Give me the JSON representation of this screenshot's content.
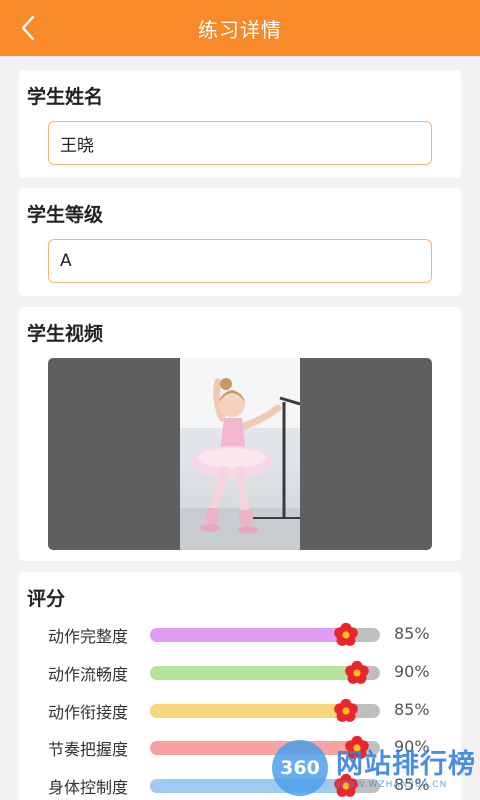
{
  "header": {
    "title": "练习详情",
    "back_icon": "chevron-left-icon"
  },
  "student_name": {
    "label": "学生姓名",
    "value": "王晓"
  },
  "student_grade": {
    "label": "学生等级",
    "value": "A"
  },
  "student_video": {
    "label": "学生视频"
  },
  "scores": {
    "label": "评分",
    "items": [
      {
        "label": "动作完整度",
        "value": "85%",
        "percent": 85,
        "color": "#e29cf2"
      },
      {
        "label": "动作流畅度",
        "value": "90%",
        "percent": 90,
        "color": "#b5e39c"
      },
      {
        "label": "动作衔接度",
        "value": "85%",
        "percent": 85,
        "color": "#f8d67a"
      },
      {
        "label": "节奏把握度",
        "value": "90%",
        "percent": 90,
        "color": "#f7a3a3"
      },
      {
        "label": "身体控制度",
        "value": "85%",
        "percent": 85,
        "color": "#9fcaf2"
      }
    ]
  },
  "colors": {
    "accent": "#f88a2a",
    "field_border": "#f3b57a",
    "track": "#bfbfbf",
    "flower": "#e8262b"
  },
  "watermark": {
    "badge": "360",
    "text": "网站排行榜",
    "sub": "WWW.WZHAN360.CN"
  }
}
